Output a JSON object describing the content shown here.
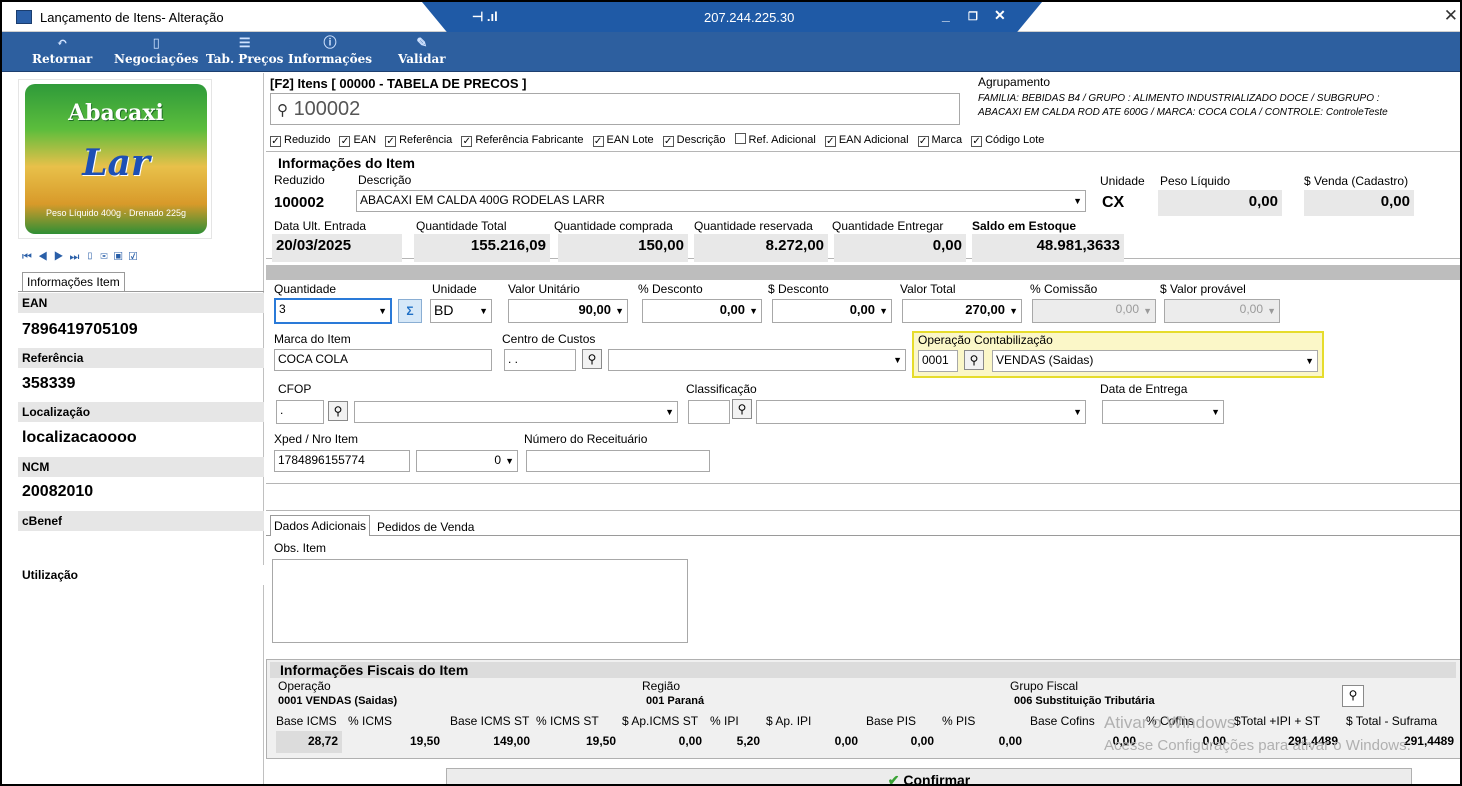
{
  "window": {
    "title": "Lançamento de Itens- Alteração",
    "remote_ip": "207.244.225.30",
    "pin": "⊣ .ıl",
    "close": "✕",
    "min": "_",
    "restore": "❐",
    "x": "✕"
  },
  "toolbar": {
    "retornar": "Retornar",
    "negociacoes": "Negociações",
    "tab_precos": "Tab. Preços",
    "informacoes": "Informações",
    "validar": "Validar"
  },
  "item_search": {
    "header": "[F2] Itens [ 00000 - TABELA DE PRECOS ]",
    "value": "100002"
  },
  "agrupamento": {
    "label": "Agrupamento",
    "line1": "FAMILIA: BEBIDAS B4 / GRUPO : ALIMENTO INDUSTRIALIZADO DOCE / SUBGRUPO :",
    "line2": "ABACAXI EM CALDA ROD ATE  600G / MARCA: COCA COLA / CONTROLE: ControleTeste"
  },
  "filters": [
    {
      "label": "Reduzido",
      "checked": true
    },
    {
      "label": "EAN",
      "checked": true
    },
    {
      "label": "Referência",
      "checked": true
    },
    {
      "label": "Referência Fabricante",
      "checked": true
    },
    {
      "label": "EAN Lote",
      "checked": true
    },
    {
      "label": "Descrição",
      "checked": true
    },
    {
      "label": "Ref. Adicional",
      "checked": false
    },
    {
      "label": "EAN Adicional",
      "checked": true
    },
    {
      "label": "Marca",
      "checked": true
    },
    {
      "label": "Código Lote",
      "checked": true
    }
  ],
  "left": {
    "tab": "Informações Item",
    "image_top": "Abacaxi",
    "image_brand": "Lar",
    "image_bottom": "Peso Líquido 400g · Drenado 225g",
    "ean_label": "EAN",
    "ean": "7896419705109",
    "ref_label": "Referência",
    "ref": "358339",
    "loc_label": "Localização",
    "loc": "localizacaoooo",
    "ncm_label": "NCM",
    "ncm": "20082010",
    "cbenef_label": "cBenef",
    "util_label": "Utilização"
  },
  "info": {
    "title": "Informações do Item",
    "reduzido_label": "Reduzido",
    "reduzido": "100002",
    "descricao_label": "Descrição",
    "descricao": "ABACAXI EM CALDA 400G RODELAS LARR",
    "unidade_label": "Unidade",
    "unidade": "CX",
    "peso_label": "Peso Líquido",
    "peso": "0,00",
    "venda_label": "$ Venda (Cadastro)",
    "venda": "0,00",
    "data_label": "Data Ult. Entrada",
    "data": "20/03/2025",
    "qtotal_label": "Quantidade Total",
    "qtotal": "155.216,09",
    "qcomprada_label": "Quantidade comprada",
    "qcomprada": "150,00",
    "qreservada_label": "Quantidade reservada",
    "qreservada": "8.272,00",
    "qentregar_label": "Quantidade Entregar",
    "qentregar": "0,00",
    "saldo_label": "Saldo em Estoque",
    "saldo": "48.981,3633"
  },
  "line": {
    "quantidade_label": "Quantidade",
    "quantidade": "3",
    "unidade_label": "Unidade",
    "unidade": "BD",
    "valor_label": "Valor Unitário",
    "valor": "90,00",
    "pdesc_label": "% Desconto",
    "pdesc": "0,00",
    "desc_label": "$ Desconto",
    "desc": "0,00",
    "total_label": "Valor Total",
    "total": "270,00",
    "comissao_label": "% Comissão",
    "comissao": "0,00",
    "provavel_label": "$ Valor provável",
    "provavel": "0,00",
    "marca_label": "Marca do Item",
    "marca": "COCA COLA",
    "custos_label": "Centro de Custos",
    "custos": ". .",
    "opcont_label": "Operação Contabilização",
    "opcont_code": "0001",
    "opcont": "VENDAS (Saidas)",
    "cfop_label": "CFOP",
    "cfop": ".",
    "classif_label": "Classificação",
    "entrega_label": "Data de Entrega",
    "xped_label": "Xped / Nro Item",
    "xped": "1784896155774",
    "nro": "0",
    "receit_label": "Número do Receituário"
  },
  "tabs": {
    "adicionais": "Dados Adicionais",
    "pedidos": "Pedidos de Venda",
    "obs_label": "Obs. Item"
  },
  "fiscal": {
    "title": "Informações Fiscais do Item",
    "operacao_label": "Operação",
    "operacao": "0001  VENDAS (Saidas)",
    "regiao_label": "Região",
    "regiao": "001   Paraná",
    "grupo_label": "Grupo Fiscal",
    "grupo": "006   Substituição Tributária",
    "headers": [
      "Base ICMS",
      "% ICMS",
      "Base ICMS ST",
      "% ICMS ST",
      "$ Ap.ICMS ST",
      "% IPI",
      "$ Ap. IPI",
      "Base PIS",
      "% PIS",
      "Base Cofins",
      "% Cofins",
      "$Total +IPI + ST",
      "$ Total - Suframa"
    ],
    "values": [
      "28,72",
      "19,50",
      "149,00",
      "19,50",
      "0,00",
      "5,20",
      "0,00",
      "0,00",
      "0,00",
      "0,00",
      "0,00",
      "291,4489",
      "291,4489"
    ]
  },
  "confirm": "Confirmar",
  "watermark": {
    "line1": "Ativar o Windows",
    "line2": "Acesse Configurações para ativar o Windows."
  }
}
